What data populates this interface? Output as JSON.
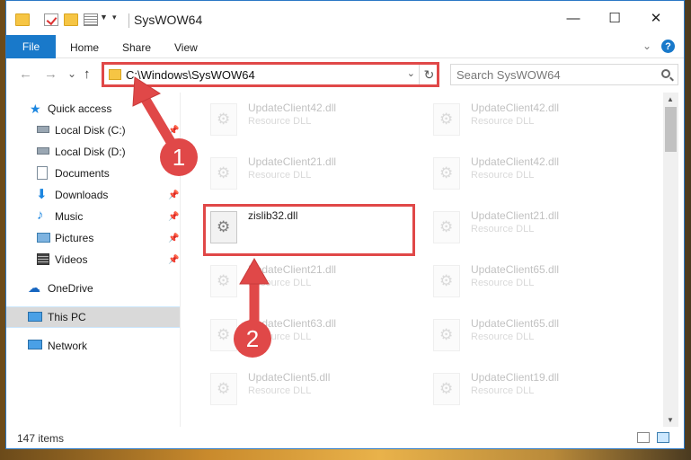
{
  "window": {
    "title": "SysWOW64"
  },
  "ribbon": {
    "file": "File",
    "home": "Home",
    "share": "Share",
    "view": "View"
  },
  "nav": {
    "back": "←",
    "forward": "→",
    "recent": "⌄",
    "up": "↑"
  },
  "address": {
    "path": "C:\\Windows\\SysWOW64"
  },
  "search": {
    "placeholder": "Search SysWOW64"
  },
  "sidebar": {
    "items": [
      {
        "label": "Quick access"
      },
      {
        "label": "Local Disk (C:)"
      },
      {
        "label": "Local Disk (D:)"
      },
      {
        "label": "Documents"
      },
      {
        "label": "Downloads"
      },
      {
        "label": "Music"
      },
      {
        "label": "Pictures"
      },
      {
        "label": "Videos"
      },
      {
        "label": "OneDrive"
      },
      {
        "label": "This PC"
      },
      {
        "label": "Network"
      }
    ]
  },
  "files": [
    {
      "name": "UpdateClient42.dll",
      "type": "Resource DLL"
    },
    {
      "name": "UpdateClient42.dll",
      "type": "Resource DLL"
    },
    {
      "name": "UpdateClient21.dll",
      "type": "Resource DLL"
    },
    {
      "name": "UpdateClient42.dll",
      "type": "Resource DLL"
    },
    {
      "name": "zislib32.dll",
      "type": ""
    },
    {
      "name": "UpdateClient21.dll",
      "type": "Resource DLL"
    },
    {
      "name": "UpdateClient21.dll",
      "type": "Resource DLL"
    },
    {
      "name": "UpdateClient65.dll",
      "type": "Resource DLL"
    },
    {
      "name": "UpdateClient63.dll",
      "type": "Resource DLL"
    },
    {
      "name": "UpdateClient65.dll",
      "type": "Resource DLL"
    },
    {
      "name": "UpdateClient5.dll",
      "type": "Resource DLL"
    },
    {
      "name": "UpdateClient19.dll",
      "type": "Resource DLL"
    }
  ],
  "status": {
    "count": "147 items"
  },
  "annotations": {
    "step1": "1",
    "step2": "2",
    "color": "#e04848"
  }
}
